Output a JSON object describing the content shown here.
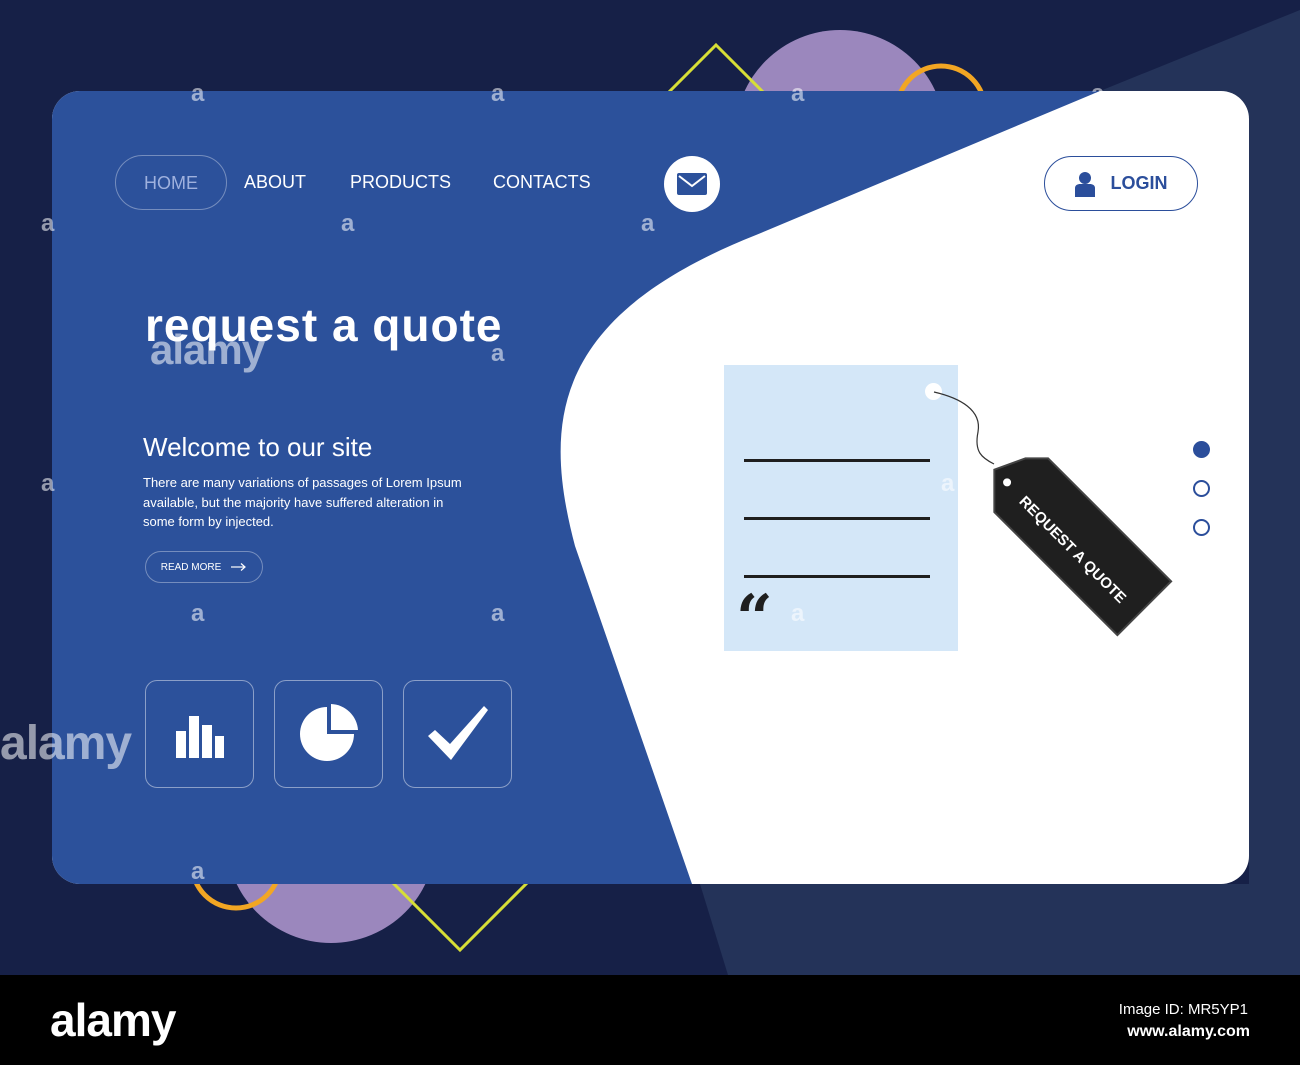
{
  "nav": {
    "home": "HOME",
    "about": "ABOUT",
    "products": "PRODUCTS",
    "contacts": "CONTACTS",
    "mail_icon": "envelope-icon",
    "login": "LOGIN",
    "login_icon": "user-icon"
  },
  "hero": {
    "title": "request a quote",
    "welcome": "Welcome to our site",
    "description": "There are many variations of passages of Lorem Ipsum available, but the majority have suffered alteration in some form by injected.",
    "read_more": "READ MORE",
    "read_more_icon": "arrow-right-icon"
  },
  "features": [
    "bar-chart-icon",
    "pie-chart-icon",
    "checkmark-icon"
  ],
  "illustration": {
    "tag_text": "REQUEST A QUOTE",
    "quote_mark": "“"
  },
  "slider": {
    "count": 3,
    "active": 1
  },
  "watermark": {
    "text": "alamy",
    "small": "a"
  },
  "footer": {
    "logo": "alamy",
    "image_id": "Image ID: MR5YP1",
    "url": "www.alamy.com"
  },
  "colors": {
    "background": "#162047",
    "card_blue": "#2c519b",
    "white": "#ffffff",
    "accent_blue": "#2b4e9b",
    "doc_blue": "#d4e7f8",
    "purple": "#9b87bd",
    "orange": "#f2a623",
    "yellow": "#d7de36"
  }
}
